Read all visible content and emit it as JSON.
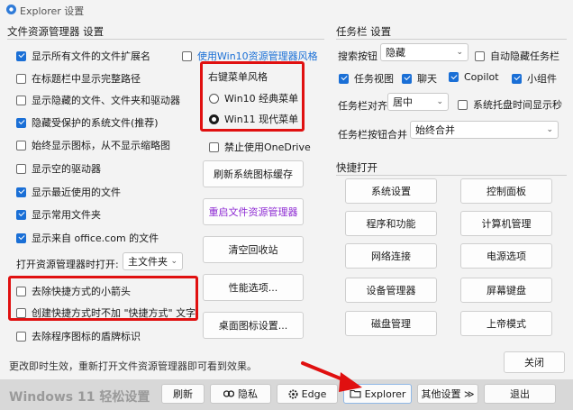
{
  "window": {
    "title": "Explorer 设置"
  },
  "explorer_settings": {
    "section_title": "文件资源管理器 设置",
    "options": [
      {
        "label": "显示所有文件的文件扩展名",
        "checked": true
      },
      {
        "label": "在标题栏中显示完整路径",
        "checked": false
      },
      {
        "label": "显示隐藏的文件、文件夹和驱动器",
        "checked": false
      },
      {
        "label": "隐藏受保护的系统文件(推荐)",
        "checked": true
      },
      {
        "label": "始终显示图标，从不显示缩略图",
        "checked": false
      },
      {
        "label": "显示空的驱动器",
        "checked": false
      },
      {
        "label": "显示最近使用的文件",
        "checked": true
      },
      {
        "label": "显示常用文件夹",
        "checked": true
      },
      {
        "label": "显示来自 office.com 的文件",
        "checked": true
      }
    ],
    "open_with_label": "打开资源管理器时打开:",
    "open_with_value": "主文件夹",
    "shortcut_options": [
      {
        "label": "去除快捷方式的小箭头",
        "checked": false
      },
      {
        "label": "创建快捷方式时不加 \"快捷方式\" 文字",
        "checked": false
      },
      {
        "label": "去除程序图标的盾牌标识",
        "checked": false
      }
    ],
    "win10_explorer": {
      "label": "使用Win10资源管理器风格",
      "checked": false
    },
    "context_menu": {
      "title": "右键菜单风格",
      "options": [
        {
          "label": "Win10 经典菜单",
          "selected": false
        },
        {
          "label": "Win11 现代菜单",
          "selected": true
        }
      ]
    },
    "onedrive": {
      "label": "禁止使用OneDrive",
      "checked": false
    },
    "buttons": {
      "refresh_icon_cache": "刷新系统图标缓存",
      "restart_explorer": "重启文件资源管理器",
      "empty_recycle": "清空回收站",
      "performance": "性能选项...",
      "desktop_icons": "桌面图标设置..."
    }
  },
  "taskbar_settings": {
    "section_title": "任务栏 设置",
    "search_label": "搜索按钮",
    "search_value": "隐藏",
    "auto_hide": {
      "label": "自动隐藏任务栏",
      "checked": false
    },
    "toggles": [
      {
        "label": "任务视图",
        "checked": true
      },
      {
        "label": "聊天",
        "checked": true
      },
      {
        "label": "Copilot",
        "checked": true
      },
      {
        "label": "小组件",
        "checked": true
      }
    ],
    "align_label": "任务栏对齐",
    "align_value": "居中",
    "tray_seconds": {
      "label": "系统托盘时间显示秒",
      "checked": false
    },
    "merge_label": "任务栏按钮合并",
    "merge_value": "始终合并"
  },
  "quick_open": {
    "section_title": "快捷打开",
    "buttons": [
      "系统设置",
      "控制面板",
      "程序和功能",
      "计算机管理",
      "网络连接",
      "电源选项",
      "设备管理器",
      "屏幕键盘",
      "磁盘管理",
      "上帝模式"
    ]
  },
  "status_text": "更改即时生效，重新打开文件资源管理器即可看到效果。",
  "close_button": "关闭",
  "bottom_bar": {
    "brand": "Windows 11 轻松设置",
    "buttons": [
      "刷新",
      "隐私",
      "Edge",
      "Explorer",
      "其他设置 ≫",
      "退出"
    ]
  },
  "colors": {
    "accent": "#1a6fd6",
    "highlight": "#e01010",
    "purple_link": "#8e2bd3"
  }
}
